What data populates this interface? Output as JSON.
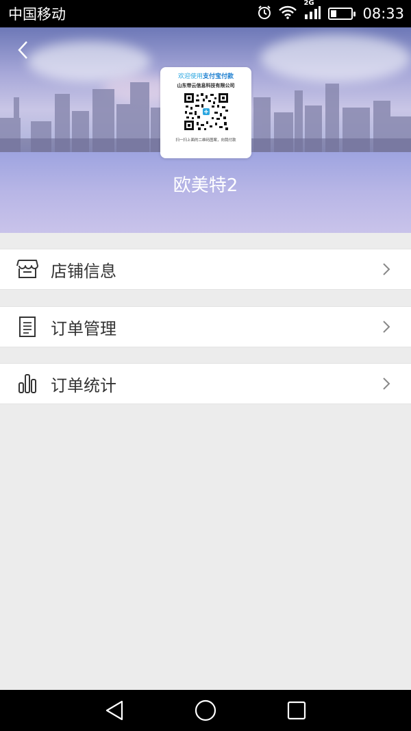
{
  "status_bar": {
    "carrier": "中国移动",
    "network": "2G",
    "time": "08:33"
  },
  "header": {
    "back_icon": "chevron-left-icon",
    "shop_name": "欧美特2"
  },
  "qr_card": {
    "welcome_prefix": "欢迎使用",
    "welcome_brand": "支付宝付款",
    "company": "山东带云信息科技有限公司",
    "hint": "扫一扫上面的二维码图案，向我付款"
  },
  "menu": {
    "items": [
      {
        "label": "店铺信息",
        "icon": "store-icon"
      },
      {
        "label": "订单管理",
        "icon": "document-icon"
      },
      {
        "label": "订单统计",
        "icon": "bar-chart-icon"
      }
    ]
  },
  "colors": {
    "accent": "#2aa6e0",
    "page_bg": "#ececec"
  }
}
